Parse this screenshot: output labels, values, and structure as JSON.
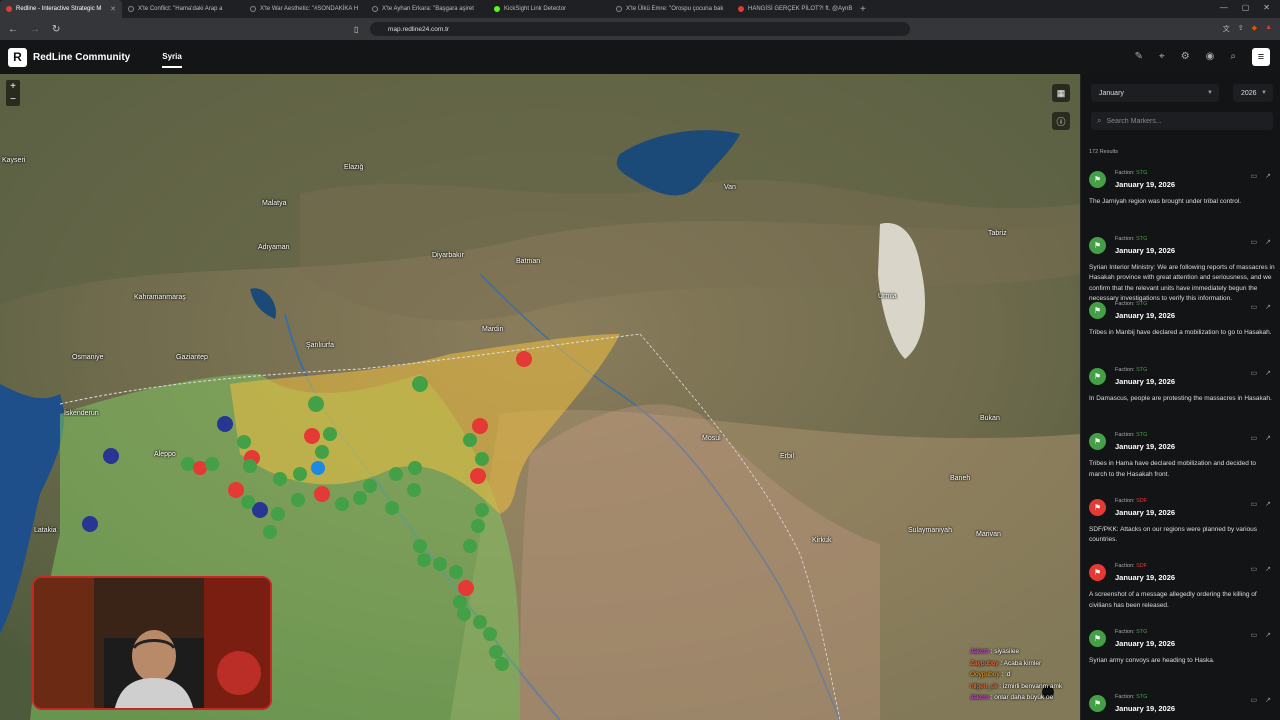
{
  "browser": {
    "tabs": [
      {
        "title": "Redline - Interactive Strategic M",
        "active": true
      },
      {
        "title": "X'te Conflict: \"Hama'daki Arap a",
        "active": false
      },
      {
        "title": "X'te War Aesthetic: \"#SONDAKİKA H",
        "active": false
      },
      {
        "title": "X'te Ayhan Erkara: \"Başgara aşiret",
        "active": false
      },
      {
        "title": "KickSight Link Detector",
        "active": false
      },
      {
        "title": "X'te Ülkü Emre: \"Orospu çocuna bak",
        "active": false
      },
      {
        "title": "HANGİSİ GERÇEK PİLOT?! ft. @AynB",
        "active": false
      }
    ],
    "new_tab": "+",
    "url": "map.redline24.com.tr"
  },
  "app": {
    "logo_letter": "R",
    "brand": "RedLine Community",
    "region_tab": "Syria",
    "menu_glyph": "≡"
  },
  "map": {
    "zoom_in": "+",
    "zoom_out": "−",
    "cities": [
      {
        "name": "Kayseri"
      },
      {
        "name": "Malatya"
      },
      {
        "name": "Elazığ"
      },
      {
        "name": "Diyarbakır"
      },
      {
        "name": "Batman"
      },
      {
        "name": "Van"
      },
      {
        "name": "Tabriz"
      },
      {
        "name": "Adıyaman"
      },
      {
        "name": "Kahramanmaraş"
      },
      {
        "name": "Gaziantep"
      },
      {
        "name": "Şanlıurfa"
      },
      {
        "name": "Mardin"
      },
      {
        "name": "Osmaniye"
      },
      {
        "name": "İskenderun"
      },
      {
        "name": "Aleppo"
      },
      {
        "name": "Latakia"
      },
      {
        "name": "Mosul"
      },
      {
        "name": "Erbil"
      },
      {
        "name": "Kirkuk"
      },
      {
        "name": "Sulaymaniyah"
      },
      {
        "name": "Marivan"
      },
      {
        "name": "Baneh"
      },
      {
        "name": "Bukan"
      },
      {
        "name": "Urmia"
      }
    ]
  },
  "chat": [
    {
      "user": "Jakcm",
      "msg": "siyasilee",
      "color": "#e040fb"
    },
    {
      "user": "Zaypuboy",
      "msg": "Acaba kimler",
      "color": "#ff7043"
    },
    {
      "user": "Ooypuboy",
      "msg": ":d",
      "color": "#ff9800"
    },
    {
      "user": "nilgen_sk",
      "msg": "izmirli benvanm amk",
      "color": "#ff7043"
    },
    {
      "user": "Jakcm",
      "msg": "onlar daha büyük oe",
      "color": "#e040fb"
    }
  ],
  "sidebar": {
    "month": "January",
    "year": "2026",
    "search_placeholder": "Search Markers...",
    "results": "172 Results",
    "faction_prefix": "Faction:",
    "items": [
      {
        "faction": "STG",
        "faction_color": "#43a047",
        "date": "January 19, 2026",
        "text": "The Jarniyah region was brought under tribal control."
      },
      {
        "faction": "STG",
        "faction_color": "#43a047",
        "date": "January 19, 2026",
        "text": "Syrian Interior Ministry: We are following reports of massacres in Hasakah province with great attention and seriousness, and we confirm that the relevant units have immediately begun the necessary investigations to verify this information."
      },
      {
        "faction": "STG",
        "faction_color": "#43a047",
        "date": "January 19, 2026",
        "text": "Tribes in Manbij have declared a mobilization to go to Hasakah."
      },
      {
        "faction": "STG",
        "faction_color": "#43a047",
        "date": "January 19, 2026",
        "text": "In Damascus, people are protesting the massacres in Hasakah."
      },
      {
        "faction": "STG",
        "faction_color": "#43a047",
        "date": "January 19, 2026",
        "text": "Tribes in Hama have declared mobilization and decided to march to the Hasakah front."
      },
      {
        "faction": "SDF",
        "faction_color": "#e53935",
        "date": "January 19, 2026",
        "text": "SDF/PKK: Attacks on our regions were planned by various countries."
      },
      {
        "faction": "SDF",
        "faction_color": "#e53935",
        "date": "January 19, 2026",
        "text": "A screenshot of a message allegedly ordering the killing of civilians has been released."
      },
      {
        "faction": "STG",
        "faction_color": "#43a047",
        "date": "January 19, 2026",
        "text": "Syrian army convoys are heading to Haska."
      },
      {
        "faction": "STG",
        "faction_color": "#43a047",
        "date": "January 19, 2026",
        "text": ""
      }
    ]
  }
}
